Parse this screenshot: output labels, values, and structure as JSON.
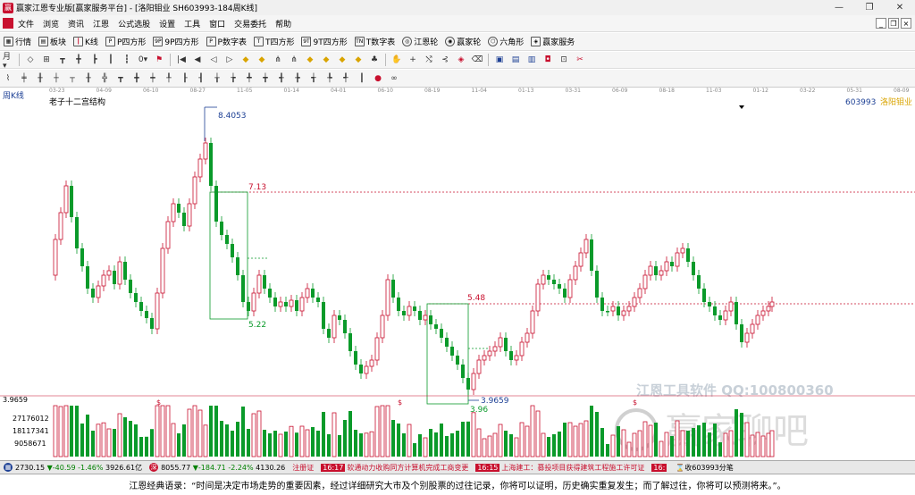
{
  "window": {
    "title": "赢家江恩专业版[赢家服务平台] - [洛阳钼业 SH603993-184周K线]",
    "minimize": "—",
    "restore": "❐",
    "close": "✕"
  },
  "menu": {
    "items": [
      "文件",
      "浏览",
      "资讯",
      "江恩",
      "公式选股",
      "设置",
      "工具",
      "窗口",
      "交易委托",
      "帮助"
    ],
    "right_controls": [
      "_",
      "❐",
      "×"
    ]
  },
  "toolbar1": {
    "items": [
      {
        "icon": "grid-icon",
        "label": "行情"
      },
      {
        "icon": "blocks-icon",
        "label": "板块"
      },
      {
        "icon": "candlestick-icon",
        "label": "K线"
      },
      {
        "icon": "P",
        "label": "P四方形"
      },
      {
        "icon": "9P",
        "label": "9P四方形"
      },
      {
        "icon": "P",
        "label": "P数字表"
      },
      {
        "icon": "T",
        "label": "T四方形"
      },
      {
        "icon": "9T",
        "label": "9T四方形"
      },
      {
        "icon": "TN",
        "label": "T数字表"
      },
      {
        "icon": "wheel-icon",
        "label": "江恩轮"
      },
      {
        "icon": "wheel-icon",
        "label": "赢家轮"
      },
      {
        "icon": "hexagon-icon",
        "label": "六角形"
      },
      {
        "icon": "service-icon",
        "label": "赢家服务"
      }
    ]
  },
  "chart": {
    "period_label": "周K线",
    "indicator_name": "老子十二宫结构",
    "stock_code": "603993",
    "stock_name": "洛阳钼业",
    "date_ticks": [
      "03-23",
      "04-09",
      "06-10",
      "08-27",
      "11-05",
      "01-14",
      "04-01",
      "06-10",
      "08-19",
      "11-04",
      "01-13",
      "03-31",
      "06-09",
      "08-18",
      "11-03",
      "01-12",
      "03-22",
      "05-31",
      "08-09"
    ],
    "price_labels": {
      "high": "8.4053",
      "level1": "7.13",
      "level2": "5.48",
      "box_low1": "5.22",
      "low_point": "3.9659",
      "low_point_alt": "3.96"
    },
    "volume_axis": [
      "3.9659",
      "27176012",
      "18117341",
      "9058671"
    ],
    "markers": [
      "$",
      "$",
      "$"
    ],
    "colors": {
      "up": "#c8102e",
      "down": "#0a9a2a",
      "level_line": "#c8102e",
      "box": "#0a9a2a"
    }
  },
  "watermark": {
    "line1": "江恩工具软件  QQ:100800360",
    "line2": "赢家聊吧"
  },
  "status": {
    "sh_index": "2730.15",
    "sh_change": "▼-40.59",
    "sh_pct": "-1.46%",
    "sh_amount": "3926.61亿",
    "sz_index": "8055.77",
    "sz_change": "▼-184.71",
    "sz_pct": "-2.24%",
    "sz_amount": "4130.26",
    "news": [
      {
        "time": "",
        "text": "注册证"
      },
      {
        "time": "16:17",
        "text": "软通动力收购同方计算机完成工商变更"
      },
      {
        "time": "16:15",
        "text": "上海建工：募投项目获得建筑工程施工许可证"
      },
      {
        "time": "16:",
        "text": ""
      }
    ],
    "favorite": "收603993分笔"
  },
  "quote": "江恩经典语录：“时间是决定市场走势的重要因素，经过详细研究大市及个别股票的过往记录，你将可以证明，历史确实重复发生；而了解过往，你将可以预测将来。”。"
}
